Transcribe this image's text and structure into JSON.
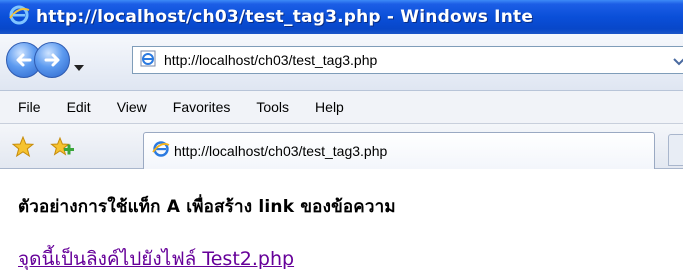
{
  "window": {
    "title": "http://localhost/ch03/test_tag3.php - Windows Inte"
  },
  "address_bar": {
    "url": "http://localhost/ch03/test_tag3.php"
  },
  "menu": {
    "items": [
      "File",
      "Edit",
      "View",
      "Favorites",
      "Tools",
      "Help"
    ]
  },
  "tab": {
    "label": "http://localhost/ch03/test_tag3.php"
  },
  "content": {
    "heading": "ตัวอย่างการใช้แท็ก A เพื่อสร้าง link ของข้อความ",
    "link_text": "จุดนี้เป็นลิงค์ไปยังไฟล์ Test2.php"
  },
  "icons": {
    "back": "back-arrow-icon",
    "forward": "forward-arrow-icon",
    "page": "ie-page-icon",
    "favorites": "star-icon",
    "add_favorite": "add-favorite-icon"
  },
  "colors": {
    "titlebar": "#0a4fd9",
    "visited_link": "#660099"
  }
}
